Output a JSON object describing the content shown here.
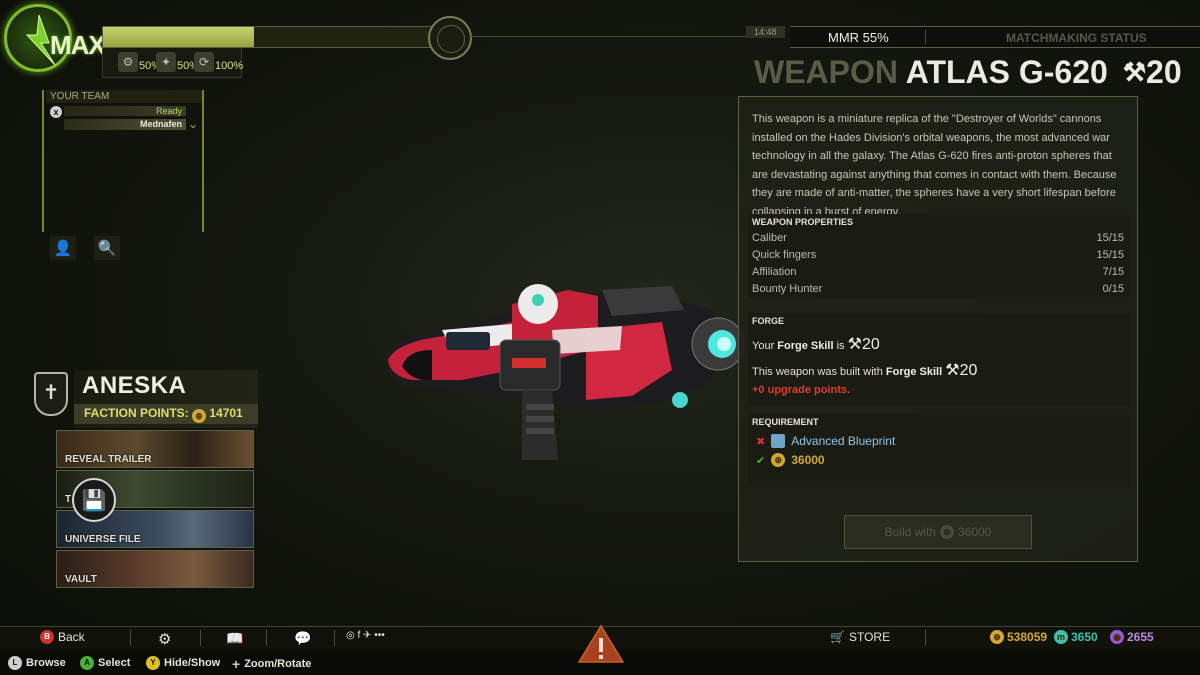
{
  "player": {
    "name": "MAX",
    "xp_fraction": 0.45,
    "boosts": [
      {
        "icon": "xp-boost-icon",
        "value": "50%"
      },
      {
        "icon": "credit-boost-icon",
        "value": "50%"
      },
      {
        "icon": "faction-boost-icon",
        "value": "100%"
      }
    ]
  },
  "team": {
    "title": "YOUR TEAM",
    "status": "Ready",
    "member": "Mednafen",
    "buttons": [
      "add-friend-icon",
      "find-friend-icon"
    ]
  },
  "faction": {
    "name": "ANESKA",
    "points_label": "FACTION POINTS:",
    "points": "14701",
    "menu": [
      {
        "label": "REVEAL TRAILER"
      },
      {
        "label": "T"
      },
      {
        "label": "UNIVERSE FILE"
      },
      {
        "label": "VAULT"
      }
    ]
  },
  "status": {
    "clock": "14:48",
    "mmr": "MMR 55%",
    "matchmaking": "MATCHMAKING STATUS"
  },
  "weapon": {
    "prefix": "WEAPON",
    "name": "ATLAS G-620",
    "forge_level": "20",
    "description": "This weapon is a miniature replica of the \"Destroyer of Worlds\" cannons installed on the Hades Division's orbital weapons, the most advanced war technology in all the galaxy. The Atlas G-620 fires anti-proton spheres that are devastating against anything that comes in contact with them. Because they are made of anti-matter, the spheres have a very short lifespan before collapsing in a burst of energy.",
    "properties_title": "WEAPON PROPERTIES",
    "properties": [
      {
        "name": "Caliber",
        "value": "15/15"
      },
      {
        "name": "Quick fingers",
        "value": "15/15"
      },
      {
        "name": "Affiliation",
        "value": "7/15"
      },
      {
        "name": "Bounty Hunter",
        "value": "0/15"
      }
    ],
    "forge_title": "FORGE",
    "forge_your_pre": "Your",
    "forge_your_bold": "Forge Skill",
    "forge_your_post": "is",
    "forge_your_value": "20",
    "forge_built_pre": "This weapon was built with",
    "forge_built_bold": "Forge Skill",
    "forge_built_value": "20",
    "upgrade_points": "+0 upgrade points.",
    "requirement_title": "REQUIREMENT",
    "requirements": [
      {
        "met": false,
        "label": "Advanced Blueprint"
      },
      {
        "met": true,
        "label": "36000"
      }
    ],
    "build_label": "Build with",
    "build_cost": "36000"
  },
  "bottom": {
    "back": "Back",
    "store": "STORE",
    "currency": [
      {
        "value": "538059",
        "color": "#d6a832"
      },
      {
        "value": "3650",
        "color": "#3cc0b0"
      },
      {
        "value": "2655",
        "color": "#9a5ad6"
      }
    ],
    "hints": [
      {
        "button": "L",
        "label": "Browse",
        "color": "#cfcfcf"
      },
      {
        "button": "A",
        "label": "Select",
        "color": "#4caf3a"
      },
      {
        "button": "Y",
        "label": "Hide/Show",
        "color": "#e0c020"
      },
      {
        "button": "+",
        "label": "Zoom/Rotate",
        "color": "#cfcfcf"
      }
    ],
    "back_button": "B",
    "back_color": "#d03030"
  }
}
